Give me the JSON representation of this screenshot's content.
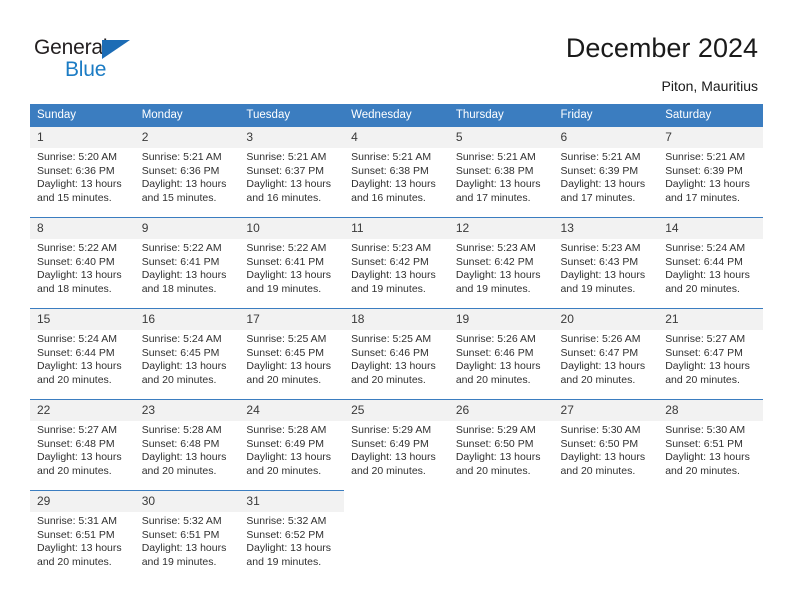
{
  "brand": {
    "name_part1": "General",
    "name_part2": "Blue",
    "triangle_color": "#1c6cb5",
    "blue_text_color": "#1c7cc4"
  },
  "header": {
    "title": "December 2024",
    "location": "Piton, Mauritius"
  },
  "theme": {
    "header_row_bg": "#3b7dc0",
    "header_row_text": "#ffffff",
    "daynum_bg": "#f2f2f2",
    "row_rule": "#3b7dc0",
    "body_text": "#303030"
  },
  "weekdays": [
    "Sunday",
    "Monday",
    "Tuesday",
    "Wednesday",
    "Thursday",
    "Friday",
    "Saturday"
  ],
  "weeks": [
    [
      {
        "day": "1",
        "sunrise": "Sunrise: 5:20 AM",
        "sunset": "Sunset: 6:36 PM",
        "daylight1": "Daylight: 13 hours",
        "daylight2": "and 15 minutes."
      },
      {
        "day": "2",
        "sunrise": "Sunrise: 5:21 AM",
        "sunset": "Sunset: 6:36 PM",
        "daylight1": "Daylight: 13 hours",
        "daylight2": "and 15 minutes."
      },
      {
        "day": "3",
        "sunrise": "Sunrise: 5:21 AM",
        "sunset": "Sunset: 6:37 PM",
        "daylight1": "Daylight: 13 hours",
        "daylight2": "and 16 minutes."
      },
      {
        "day": "4",
        "sunrise": "Sunrise: 5:21 AM",
        "sunset": "Sunset: 6:38 PM",
        "daylight1": "Daylight: 13 hours",
        "daylight2": "and 16 minutes."
      },
      {
        "day": "5",
        "sunrise": "Sunrise: 5:21 AM",
        "sunset": "Sunset: 6:38 PM",
        "daylight1": "Daylight: 13 hours",
        "daylight2": "and 17 minutes."
      },
      {
        "day": "6",
        "sunrise": "Sunrise: 5:21 AM",
        "sunset": "Sunset: 6:39 PM",
        "daylight1": "Daylight: 13 hours",
        "daylight2": "and 17 minutes."
      },
      {
        "day": "7",
        "sunrise": "Sunrise: 5:21 AM",
        "sunset": "Sunset: 6:39 PM",
        "daylight1": "Daylight: 13 hours",
        "daylight2": "and 17 minutes."
      }
    ],
    [
      {
        "day": "8",
        "sunrise": "Sunrise: 5:22 AM",
        "sunset": "Sunset: 6:40 PM",
        "daylight1": "Daylight: 13 hours",
        "daylight2": "and 18 minutes."
      },
      {
        "day": "9",
        "sunrise": "Sunrise: 5:22 AM",
        "sunset": "Sunset: 6:41 PM",
        "daylight1": "Daylight: 13 hours",
        "daylight2": "and 18 minutes."
      },
      {
        "day": "10",
        "sunrise": "Sunrise: 5:22 AM",
        "sunset": "Sunset: 6:41 PM",
        "daylight1": "Daylight: 13 hours",
        "daylight2": "and 19 minutes."
      },
      {
        "day": "11",
        "sunrise": "Sunrise: 5:23 AM",
        "sunset": "Sunset: 6:42 PM",
        "daylight1": "Daylight: 13 hours",
        "daylight2": "and 19 minutes."
      },
      {
        "day": "12",
        "sunrise": "Sunrise: 5:23 AM",
        "sunset": "Sunset: 6:42 PM",
        "daylight1": "Daylight: 13 hours",
        "daylight2": "and 19 minutes."
      },
      {
        "day": "13",
        "sunrise": "Sunrise: 5:23 AM",
        "sunset": "Sunset: 6:43 PM",
        "daylight1": "Daylight: 13 hours",
        "daylight2": "and 19 minutes."
      },
      {
        "day": "14",
        "sunrise": "Sunrise: 5:24 AM",
        "sunset": "Sunset: 6:44 PM",
        "daylight1": "Daylight: 13 hours",
        "daylight2": "and 20 minutes."
      }
    ],
    [
      {
        "day": "15",
        "sunrise": "Sunrise: 5:24 AM",
        "sunset": "Sunset: 6:44 PM",
        "daylight1": "Daylight: 13 hours",
        "daylight2": "and 20 minutes."
      },
      {
        "day": "16",
        "sunrise": "Sunrise: 5:24 AM",
        "sunset": "Sunset: 6:45 PM",
        "daylight1": "Daylight: 13 hours",
        "daylight2": "and 20 minutes."
      },
      {
        "day": "17",
        "sunrise": "Sunrise: 5:25 AM",
        "sunset": "Sunset: 6:45 PM",
        "daylight1": "Daylight: 13 hours",
        "daylight2": "and 20 minutes."
      },
      {
        "day": "18",
        "sunrise": "Sunrise: 5:25 AM",
        "sunset": "Sunset: 6:46 PM",
        "daylight1": "Daylight: 13 hours",
        "daylight2": "and 20 minutes."
      },
      {
        "day": "19",
        "sunrise": "Sunrise: 5:26 AM",
        "sunset": "Sunset: 6:46 PM",
        "daylight1": "Daylight: 13 hours",
        "daylight2": "and 20 minutes."
      },
      {
        "day": "20",
        "sunrise": "Sunrise: 5:26 AM",
        "sunset": "Sunset: 6:47 PM",
        "daylight1": "Daylight: 13 hours",
        "daylight2": "and 20 minutes."
      },
      {
        "day": "21",
        "sunrise": "Sunrise: 5:27 AM",
        "sunset": "Sunset: 6:47 PM",
        "daylight1": "Daylight: 13 hours",
        "daylight2": "and 20 minutes."
      }
    ],
    [
      {
        "day": "22",
        "sunrise": "Sunrise: 5:27 AM",
        "sunset": "Sunset: 6:48 PM",
        "daylight1": "Daylight: 13 hours",
        "daylight2": "and 20 minutes."
      },
      {
        "day": "23",
        "sunrise": "Sunrise: 5:28 AM",
        "sunset": "Sunset: 6:48 PM",
        "daylight1": "Daylight: 13 hours",
        "daylight2": "and 20 minutes."
      },
      {
        "day": "24",
        "sunrise": "Sunrise: 5:28 AM",
        "sunset": "Sunset: 6:49 PM",
        "daylight1": "Daylight: 13 hours",
        "daylight2": "and 20 minutes."
      },
      {
        "day": "25",
        "sunrise": "Sunrise: 5:29 AM",
        "sunset": "Sunset: 6:49 PM",
        "daylight1": "Daylight: 13 hours",
        "daylight2": "and 20 minutes."
      },
      {
        "day": "26",
        "sunrise": "Sunrise: 5:29 AM",
        "sunset": "Sunset: 6:50 PM",
        "daylight1": "Daylight: 13 hours",
        "daylight2": "and 20 minutes."
      },
      {
        "day": "27",
        "sunrise": "Sunrise: 5:30 AM",
        "sunset": "Sunset: 6:50 PM",
        "daylight1": "Daylight: 13 hours",
        "daylight2": "and 20 minutes."
      },
      {
        "day": "28",
        "sunrise": "Sunrise: 5:30 AM",
        "sunset": "Sunset: 6:51 PM",
        "daylight1": "Daylight: 13 hours",
        "daylight2": "and 20 minutes."
      }
    ],
    [
      {
        "day": "29",
        "sunrise": "Sunrise: 5:31 AM",
        "sunset": "Sunset: 6:51 PM",
        "daylight1": "Daylight: 13 hours",
        "daylight2": "and 20 minutes."
      },
      {
        "day": "30",
        "sunrise": "Sunrise: 5:32 AM",
        "sunset": "Sunset: 6:51 PM",
        "daylight1": "Daylight: 13 hours",
        "daylight2": "and 19 minutes."
      },
      {
        "day": "31",
        "sunrise": "Sunrise: 5:32 AM",
        "sunset": "Sunset: 6:52 PM",
        "daylight1": "Daylight: 13 hours",
        "daylight2": "and 19 minutes."
      },
      {
        "day": "",
        "sunrise": "",
        "sunset": "",
        "daylight1": "",
        "daylight2": ""
      },
      {
        "day": "",
        "sunrise": "",
        "sunset": "",
        "daylight1": "",
        "daylight2": ""
      },
      {
        "day": "",
        "sunrise": "",
        "sunset": "",
        "daylight1": "",
        "daylight2": ""
      },
      {
        "day": "",
        "sunrise": "",
        "sunset": "",
        "daylight1": "",
        "daylight2": ""
      }
    ]
  ]
}
